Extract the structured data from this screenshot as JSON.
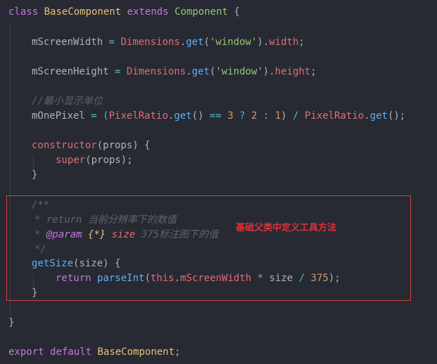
{
  "code": {
    "l1": {
      "kw_class": "class",
      "name": "BaseComponent",
      "kw_extends": "extends",
      "parent": "Component",
      "brace": "{"
    },
    "l2": {
      "var": "mScreenWidth",
      "eq": "=",
      "obj": "Dimensions",
      "dot1": ".",
      "fn": "get",
      "open": "(",
      "arg": "'window'",
      "close": ").",
      "prop": "width",
      "end": ";"
    },
    "l3": {
      "var": "mScreenHeight",
      "eq": "=",
      "obj": "Dimensions",
      "dot1": ".",
      "fn": "get",
      "open": "(",
      "arg": "'window'",
      "close": ").",
      "prop": "height",
      "end": ";"
    },
    "l4": {
      "comment": "//最小显示单位"
    },
    "l5": {
      "var": "mOnePixel",
      "eq": "= (",
      "obj": "PixelRatio",
      "dot": ".",
      "fn": "get",
      "call": "()",
      "op1": "==",
      "n3": "3",
      "q": "?",
      "n2": "2",
      "colon": ":",
      "n1": "1",
      "close": ")",
      "div": "/",
      "obj2": "PixelRatio",
      "dot2": ".",
      "fn2": "get",
      "end": "();"
    },
    "l6": {
      "name": "constructor",
      "args": "(props) {"
    },
    "l7": {
      "kw": "super",
      "args": "(props);"
    },
    "l8": {
      "brace": "}"
    },
    "l9": {
      "open": "/**"
    },
    "l10": {
      "star": "*",
      "tag": "return",
      "text": "当前分辨率下的数值"
    },
    "l11": {
      "star": "*",
      "tag": "@param",
      "type": "{*}",
      "param": "size",
      "text": "375标注图下的值"
    },
    "l12": {
      "close": "*/"
    },
    "l13": {
      "name": "getSize",
      "args": "(size) {"
    },
    "l14": {
      "kw": "return",
      "fn": "parseInt",
      "open": "(",
      "this": "this",
      "dot": ".",
      "prop": "mScreenWidth",
      "mul": "*",
      "size": "size",
      "div": "/",
      "num": "375",
      "end": ");"
    },
    "l15": {
      "brace": "}"
    },
    "l16": {
      "brace": "}"
    },
    "l17": {
      "kw_export": "export",
      "kw_default": "default",
      "name": "BaseComponent",
      "end": ";"
    }
  },
  "annotation": {
    "text": "基础父类中定义工具方法",
    "color": "#e0303a"
  },
  "colors": {
    "background": "#272a33",
    "highlight_box": "#d93b3b"
  }
}
